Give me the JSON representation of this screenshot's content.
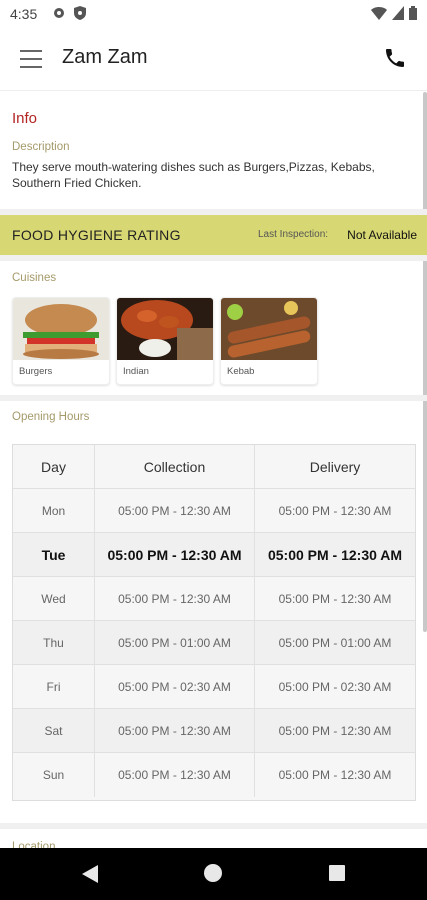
{
  "status_bar": {
    "time": "4:35"
  },
  "app_bar": {
    "title": "Zam Zam"
  },
  "info": {
    "title": "Info",
    "description_label": "Description",
    "description": "They serve mouth-watering dishes such as Burgers,Pizzas, Kebabs, Southern Fried Chicken."
  },
  "hygiene": {
    "title": "FOOD HYGIENE RATING",
    "inspection_label": "Last Inspection:",
    "inspection_value": "Not Available",
    "color": "#d7d873"
  },
  "cuisines": {
    "label": "Cuisines",
    "items": [
      {
        "name": "Burgers"
      },
      {
        "name": "Indian"
      },
      {
        "name": "Kebab"
      }
    ]
  },
  "opening_hours": {
    "label": "Opening Hours",
    "columns": [
      "Day",
      "Collection",
      "Delivery"
    ],
    "rows": [
      {
        "day": "Mon",
        "collection": "05:00 PM - 12:30 AM",
        "delivery": "05:00 PM - 12:30 AM"
      },
      {
        "day": "Tue",
        "collection": "05:00 PM - 12:30 AM",
        "delivery": "05:00 PM - 12:30 AM"
      },
      {
        "day": "Wed",
        "collection": "05:00 PM - 12:30 AM",
        "delivery": "05:00 PM - 12:30 AM"
      },
      {
        "day": "Thu",
        "collection": "05:00 PM - 01:00 AM",
        "delivery": "05:00 PM - 01:00 AM"
      },
      {
        "day": "Fri",
        "collection": "05:00 PM - 02:30 AM",
        "delivery": "05:00 PM - 02:30 AM"
      },
      {
        "day": "Sat",
        "collection": "05:00 PM - 12:30 AM",
        "delivery": "05:00 PM - 12:30 AM"
      },
      {
        "day": "Sun",
        "collection": "05:00 PM - 12:30 AM",
        "delivery": "05:00 PM - 12:30 AM"
      }
    ]
  },
  "location": {
    "label": "Location"
  },
  "colors": {
    "accent_red": "#b32424",
    "label_gold": "#a59a6a"
  }
}
